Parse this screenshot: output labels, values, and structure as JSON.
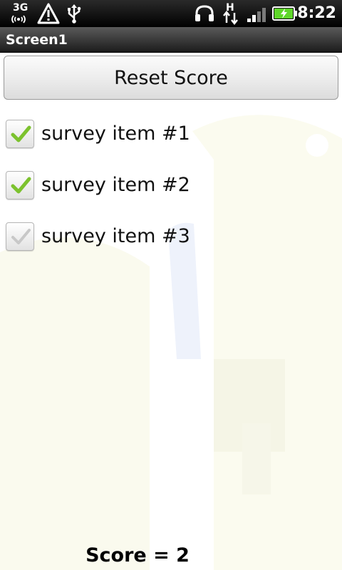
{
  "status_bar": {
    "network_type": "3G",
    "time": "8:22",
    "icons": [
      "network-3g-icon",
      "warning-icon",
      "usb-icon",
      "headphones-icon",
      "hsdpa-data-icon",
      "signal-bars-icon",
      "battery-charging-icon"
    ]
  },
  "title_bar": {
    "title": "Screen1"
  },
  "reset_button": {
    "label": "Reset Score"
  },
  "survey_items": [
    {
      "label": "survey item #1",
      "checked": true
    },
    {
      "label": "survey item #2",
      "checked": true
    },
    {
      "label": "survey item #3",
      "checked": false
    }
  ],
  "score": {
    "text": "Score = 2"
  },
  "colors": {
    "check_green": "#7cc22e",
    "check_unchecked": "#c8c8c8",
    "battery_green": "#5fd62a"
  }
}
